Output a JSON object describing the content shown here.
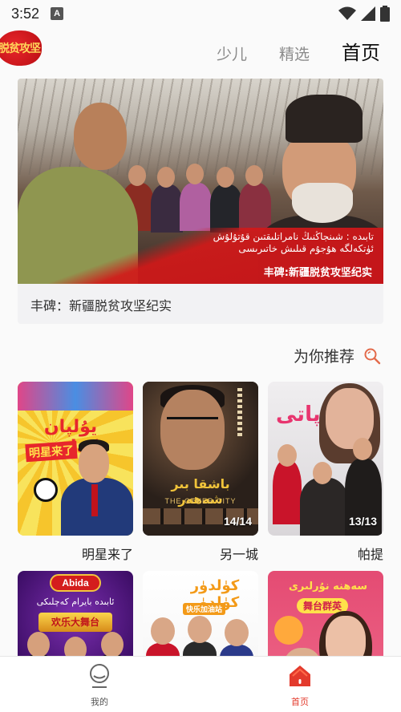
{
  "status_bar": {
    "time": "3:52",
    "notification": "A"
  },
  "header": {
    "logo_text": "脱贫攻坚",
    "tabs": [
      {
        "label": "少儿"
      },
      {
        "label": "精选"
      },
      {
        "label": "首页",
        "active": true
      }
    ]
  },
  "banner": {
    "overlay_uyghur_line1": "تابىدە : شىنجاڭنىڭ نامراتلىقتىن قۇتۇلۇش",
    "overlay_uyghur_line2": "ئۈتكەلگە ھۇجۇم قىلىش خاتىرىسى",
    "overlay_chinese": "丰碑:新疆脱贫攻坚纪实",
    "caption": "丰碑：新疆脱贫攻坚纪实"
  },
  "recommend": {
    "title": "为你推荐"
  },
  "grid": [
    {
      "title": "明星来了",
      "poster_uyghur": "يۇلپان كەلدى",
      "poster_tag": "明星来了"
    },
    {
      "title": "另一城",
      "poster_uyghur": "باشقا بىر شەھەر",
      "poster_en": "THE OTHER CITY",
      "badge": "14/14"
    },
    {
      "title": "帕提",
      "poster_uyghur": "پاتى",
      "badge": "13/13"
    },
    {
      "title": "",
      "poster_logo": "Abida",
      "poster_uyghur": "ئابىدە بايرام كەچلىكى",
      "poster_tag": "欢乐大舞台"
    },
    {
      "title": "",
      "poster_uyghur": "كۈلدۈر كۈلدۈر",
      "poster_tag": "快乐加油站"
    },
    {
      "title": "",
      "poster_uyghur": "سەھنە نۇرلىرى",
      "poster_tag": "舞台群英"
    }
  ],
  "bottom_nav": {
    "items": [
      {
        "label": "我的",
        "icon": "profile-icon"
      },
      {
        "label": "首页",
        "icon": "home-icon",
        "active": true
      }
    ]
  },
  "colors": {
    "accent": "#e33a2c",
    "text_primary": "#111111",
    "text_secondary": "#8a8a8a"
  }
}
